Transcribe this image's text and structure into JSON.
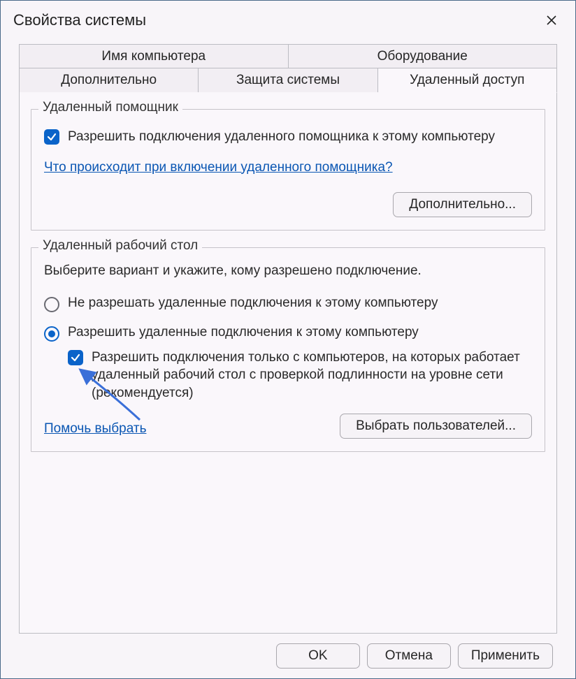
{
  "window": {
    "title": "Свойства системы"
  },
  "tabs": {
    "row1": [
      {
        "label": "Имя компьютера"
      },
      {
        "label": "Оборудование"
      }
    ],
    "row2": [
      {
        "label": "Дополнительно"
      },
      {
        "label": "Защита системы"
      },
      {
        "label": "Удаленный доступ",
        "active": true
      }
    ]
  },
  "group_assistant": {
    "legend": "Удаленный помощник",
    "checkbox_label": "Разрешить подключения удаленного помощника к этому компьютеру",
    "checkbox_checked": true,
    "help_link": "Что происходит при включении удаленного помощника?",
    "advanced_button": "Дополнительно..."
  },
  "group_rdp": {
    "legend": "Удаленный рабочий стол",
    "intro": "Выберите вариант и укажите, кому разрешено подключение.",
    "radio_deny": "Не разрешать удаленные подключения к этому компьютеру",
    "radio_allow": "Разрешить удаленные подключения к этому компьютеру",
    "radio_selected": "allow",
    "nla_checkbox_label": "Разрешить подключения только с компьютеров, на которых работает удаленный рабочий стол с проверкой подлинности на уровне сети (рекомендуется)",
    "nla_checked": true,
    "help_link": "Помочь выбрать",
    "select_users_button": "Выбрать пользователей..."
  },
  "dialog_buttons": {
    "ok": "OK",
    "cancel": "Отмена",
    "apply": "Применить"
  }
}
